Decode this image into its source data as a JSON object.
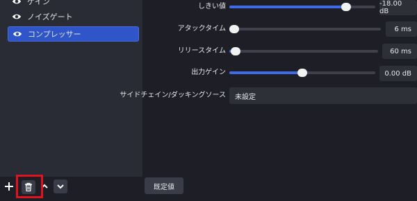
{
  "filters": {
    "items": [
      {
        "label": "ゲイン",
        "selected": false,
        "icon": "eye-icon"
      },
      {
        "label": "ノイズゲート",
        "selected": false,
        "icon": "eye-icon"
      },
      {
        "label": "コンプレッサー",
        "selected": true,
        "icon": "eye-icon"
      }
    ]
  },
  "settings": {
    "threshold": {
      "label": "しきい値",
      "value_text": "-18.00 dB",
      "level": 0.8
    },
    "attack": {
      "label": "アタックタイム",
      "value_text": "6 ms",
      "level": 0.03
    },
    "release": {
      "label": "リリースタイム",
      "value_text": "60 ms",
      "level": 0.04
    },
    "output_gain": {
      "label": "出力ゲイン",
      "value_text": "0.00 dB",
      "level": 0.5
    },
    "sidechain": {
      "label": "サイドチェイン/ダッキングソース",
      "value": "未設定"
    }
  },
  "toolbar": {
    "add_icon": "plus-icon",
    "remove_icon": "trash-icon",
    "up_icon": "chevron-up-icon",
    "down_icon": "chevron-down-icon",
    "defaults_label": "既定値"
  },
  "colors": {
    "accent": "#3e6be6",
    "selected_item": "#2f55c9",
    "highlight_box": "#e0141e"
  }
}
